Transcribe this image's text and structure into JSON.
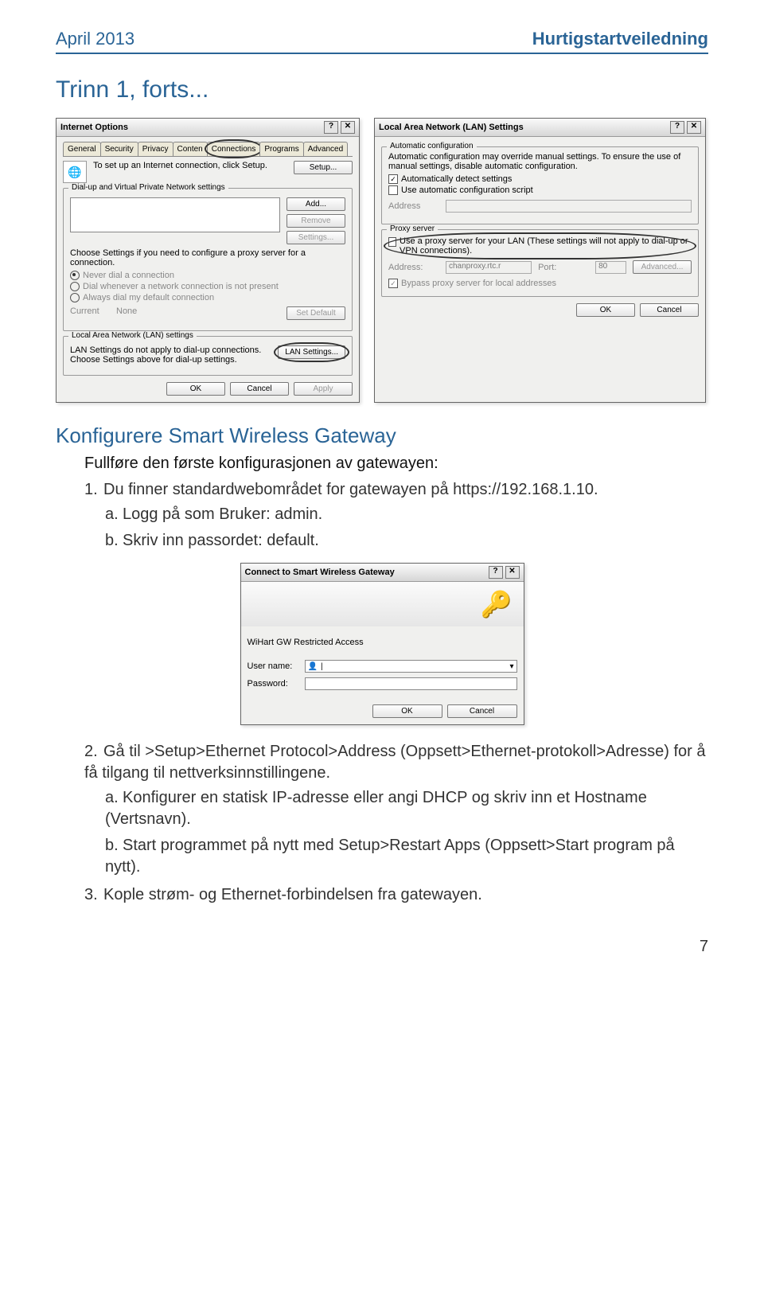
{
  "header": {
    "left": "April 2013",
    "right": "Hurtigstartveiledning"
  },
  "section_title": "Trinn 1, forts...",
  "sub_title": "Konfigurere Smart Wireless Gateway",
  "intro": "Fullføre den første konfigurasjonen av gatewayen:",
  "step1": {
    "num": "1.",
    "text": "Du finner standardwebområdet for gatewayen på https://192.168.1.10.",
    "a_let": "a.",
    "a": "Logg på som Bruker: admin.",
    "b_let": "b.",
    "b": "Skriv inn passordet: default."
  },
  "step2": {
    "num": "2.",
    "text": "Gå til >Setup>Ethernet Protocol>Address (Oppsett>Ethernet-protokoll>Adresse) for å få tilgang til nettverksinnstillingene.",
    "a_let": "a.",
    "a": "Konfigurer en statisk IP-adresse eller angi DHCP og skriv inn et Hostname (Vertsnavn).",
    "b_let": "b.",
    "b": "Start programmet på nytt med Setup>Restart Apps (Oppsett>Start program på nytt)."
  },
  "step3": {
    "num": "3.",
    "text": "Kople strøm- og Ethernet-forbindelsen fra gatewayen."
  },
  "d1": {
    "title": "Internet Options",
    "tabs": {
      "general": "General",
      "security": "Security",
      "privacy": "Privacy",
      "content": "Conten",
      "connections": "Connections",
      "programs": "Programs",
      "advanced": "Advanced"
    },
    "setup_text": "To set up an Internet connection, click Setup.",
    "btn_setup": "Setup...",
    "grp_dial": "Dial-up and Virtual Private Network settings",
    "btn_add": "Add...",
    "btn_remove": "Remove",
    "btn_settings": "Settings...",
    "btn_setdefault": "Set Default",
    "choose": "Choose Settings if you need to configure a proxy server for a connection.",
    "r1": "Never dial a connection",
    "r2": "Dial whenever a network connection is not present",
    "r3": "Always dial my default connection",
    "current": "Current",
    "none": "None",
    "grp_lan": "Local Area Network (LAN) settings",
    "lan_text": "LAN Settings do not apply to dial-up connections. Choose Settings above for dial-up settings.",
    "btn_lan": "LAN Settings...",
    "ok": "OK",
    "cancel": "Cancel",
    "apply": "Apply"
  },
  "d2": {
    "title": "Local Area Network (LAN) Settings",
    "grp_auto": "Automatic configuration",
    "auto_text": "Automatic configuration may override manual settings. To ensure the use of manual settings, disable automatic configuration.",
    "c1": "Automatically detect settings",
    "c2": "Use automatic configuration script",
    "addr_label": "Address",
    "grp_proxy": "Proxy server",
    "proxy_text": "Use a proxy server for your LAN (These settings will not apply to dial-up or VPN connections).",
    "addr2": "Address:",
    "addr2_val": "chanproxy.rtc.r",
    "port": "Port:",
    "port_val": "80",
    "advanced": "Advanced...",
    "bypass": "Bypass proxy server for local addresses",
    "ok": "OK",
    "cancel": "Cancel"
  },
  "d3": {
    "title": "Connect to Smart Wireless Gateway",
    "sub": "WiHart GW Restricted Access",
    "user": "User name:",
    "pass": "Password:",
    "ok": "OK",
    "cancel": "Cancel"
  },
  "page_num": "7"
}
